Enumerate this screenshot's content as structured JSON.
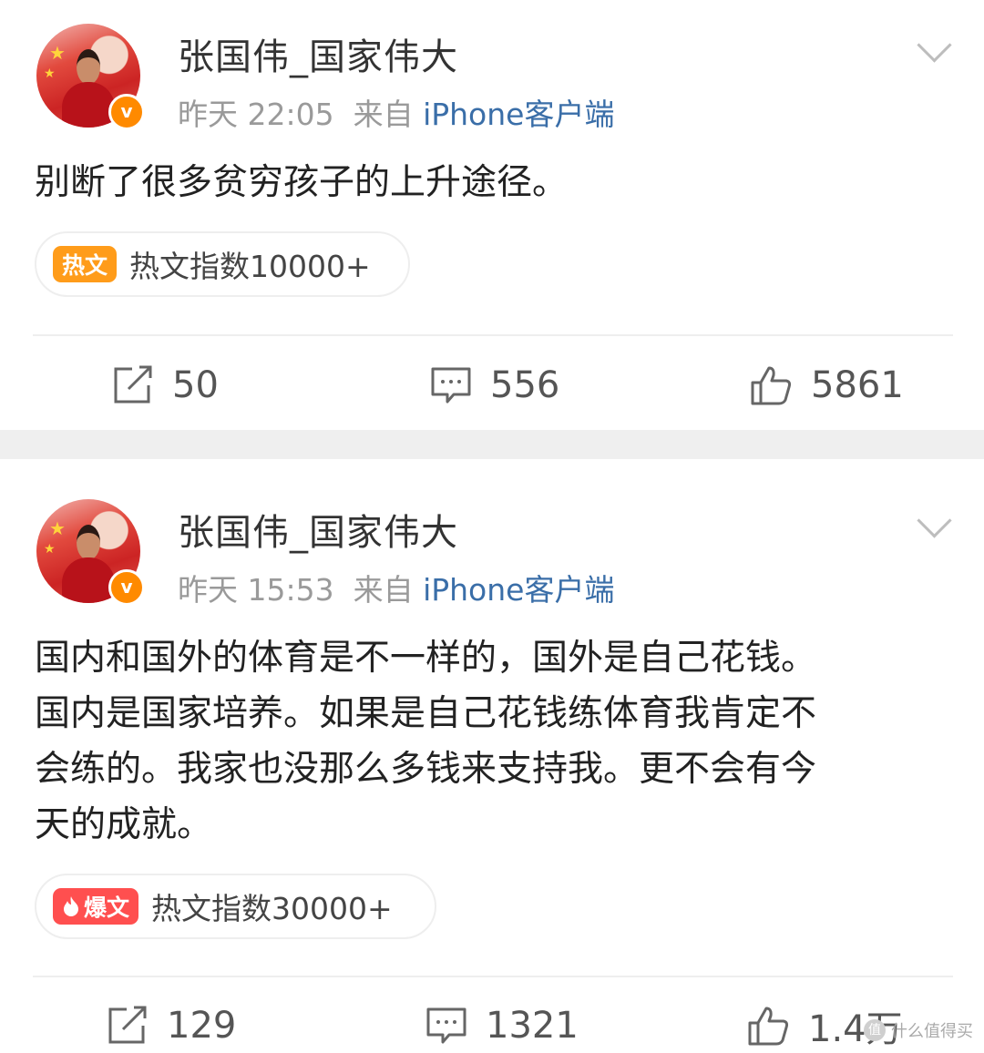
{
  "posts": [
    {
      "username": "张国伟_国家伟大",
      "timestamp": "昨天 22:05",
      "source_prefix": "来自",
      "source_name": "iPhone客户端",
      "verified_badge": "v",
      "content_lines": [
        "别断了很多贫穷孩子的上升途径。"
      ],
      "hot_tag": "热文",
      "hot_index": "热文指数10000+",
      "repost_count": "50",
      "comment_count": "556",
      "like_count": "5861"
    },
    {
      "username": "张国伟_国家伟大",
      "timestamp": "昨天 15:53",
      "source_prefix": "来自",
      "source_name": "iPhone客户端",
      "verified_badge": "v",
      "content_lines": [
        "国内和国外的体育是不一样的，国外是自己花钱。",
        "国内是国家培养。如果是自己花钱练体育我肯定不",
        "会练的。我家也没那么多钱来支持我。更不会有今",
        "天的成就。"
      ],
      "hot_tag": "爆文",
      "hot_index": "热文指数30000+",
      "repost_count": "129",
      "comment_count": "1321",
      "like_count": "1.4万"
    }
  ],
  "watermark": {
    "icon": "值",
    "text": "什么值得买"
  },
  "colors": {
    "hot_tag_orange": "#ff9c1a",
    "hot_tag_red": "#ff4f4f",
    "verified_badge": "#ff8a00",
    "source_link": "#3a6ea8",
    "separator": "#efefef"
  },
  "icons": [
    "avatar",
    "verified-badge",
    "chevron-down-icon",
    "repost-icon",
    "comment-icon",
    "like-icon",
    "flame-icon"
  ]
}
